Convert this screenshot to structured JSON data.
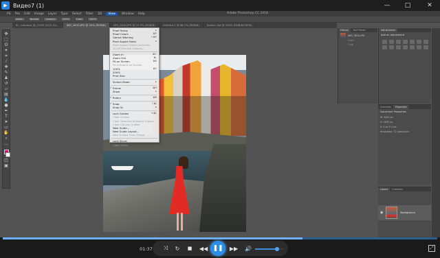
{
  "player": {
    "title": "Видео7 (1)",
    "app_icon": "play-icon",
    "window_controls": [
      "minimize-icon",
      "maximize-icon",
      "close-icon"
    ]
  },
  "photoshop": {
    "app_title": "Adobe Photoshop CC 2018",
    "menubar": [
      "PS",
      "File",
      "Edit",
      "Image",
      "Layer",
      "Type",
      "Select",
      "Filter",
      "3D",
      "View",
      "Window",
      "Help"
    ],
    "active_menu": "View",
    "options_chips": [
      "Mode:",
      "Normal",
      "Opacity:",
      "100%",
      "Flow:",
      "100%"
    ],
    "doc_tabs": [
      {
        "label": "Ki...ndscape_@_CODE 2015 (0)...",
        "active": false
      },
      {
        "label": "IMG_0610.JPG @ 25% (RGB/8)",
        "active": true
      },
      {
        "label": "IMG_0610.JPG @ 13.3% (RGB/8)",
        "active": false
      },
      {
        "label": "Untitled-1 @ 66.7% (RGB/8)",
        "active": false
      },
      {
        "label": "Screen 1pt @ 100% (RGB/8/CMYK)",
        "active": false
      }
    ]
  },
  "view_menu": [
    {
      "label": "Proof Setup",
      "shortcut": "▸",
      "disabled": false,
      "check": false
    },
    {
      "label": "Proof Colors",
      "shortcut": "⌘Y",
      "disabled": false,
      "check": false
    },
    {
      "label": "Gamut Warning",
      "shortcut": "⇧⌘Y",
      "disabled": false,
      "check": false
    },
    {
      "label": "Pixel Aspect Ratio",
      "shortcut": "▸",
      "disabled": false,
      "check": false
    },
    {
      "label": "Pixel Aspect Ratio Correction",
      "shortcut": "",
      "disabled": true,
      "check": false
    },
    {
      "label": "32-bit Preview Options...",
      "shortcut": "",
      "disabled": true,
      "check": false
    },
    {
      "sep": true
    },
    {
      "label": "Zoom In",
      "shortcut": "⌘+",
      "disabled": false,
      "check": false
    },
    {
      "label": "Zoom Out",
      "shortcut": "⌘-",
      "disabled": false,
      "check": false
    },
    {
      "label": "Fit on Screen",
      "shortcut": "⌘0",
      "disabled": false,
      "check": false
    },
    {
      "label": "Fit Artboard on Screen",
      "shortcut": "",
      "disabled": true,
      "check": false
    },
    {
      "label": "100%",
      "shortcut": "⌘1",
      "disabled": false,
      "check": false
    },
    {
      "label": "200%",
      "shortcut": "",
      "disabled": false,
      "check": false
    },
    {
      "label": "Print Size",
      "shortcut": "",
      "disabled": false,
      "check": false
    },
    {
      "sep": true
    },
    {
      "label": "Screen Mode",
      "shortcut": "▸",
      "disabled": false,
      "check": false
    },
    {
      "sep": true
    },
    {
      "label": "Extras",
      "shortcut": "⌘H",
      "disabled": false,
      "check": true
    },
    {
      "label": "Show",
      "shortcut": "▸",
      "disabled": false,
      "check": false
    },
    {
      "sep": true
    },
    {
      "label": "Rulers",
      "shortcut": "⌘R",
      "disabled": false,
      "check": true
    },
    {
      "sep": true
    },
    {
      "label": "Snap",
      "shortcut": "⇧⌘;",
      "disabled": false,
      "check": true
    },
    {
      "label": "Snap To",
      "shortcut": "▸",
      "disabled": false,
      "check": false
    },
    {
      "sep": true
    },
    {
      "label": "Lock Guides",
      "shortcut": "⌥⌘;",
      "disabled": false,
      "check": false
    },
    {
      "label": "Clear Guides",
      "shortcut": "",
      "disabled": true,
      "check": false
    },
    {
      "label": "Clear Selected Artboard Guides",
      "shortcut": "",
      "disabled": true,
      "check": false
    },
    {
      "label": "Clear Canvas Guides",
      "shortcut": "",
      "disabled": true,
      "check": false
    },
    {
      "label": "New Guide...",
      "shortcut": "",
      "disabled": false,
      "check": false
    },
    {
      "label": "New Guide Layout...",
      "shortcut": "",
      "disabled": false,
      "check": false
    },
    {
      "label": "New Guides From Shape",
      "shortcut": "",
      "disabled": true,
      "check": false
    },
    {
      "sep": true
    },
    {
      "label": "Lock Slices",
      "shortcut": "",
      "disabled": false,
      "check": false
    },
    {
      "label": "Clear Slices",
      "shortcut": "",
      "disabled": true,
      "check": false
    }
  ],
  "panels": {
    "history_tabs": [
      "History",
      "Tool Preset"
    ],
    "history_item": "IMG_0610.JPG",
    "history_sub": [
      "Open",
      "Crop"
    ],
    "adjust_tabs": [
      "Adjustments"
    ],
    "adjust_title": "Add an adjustment",
    "props_tabs": [
      "Channels",
      "Properties"
    ],
    "props_title": "Document Properties",
    "props_lines": [
      "W: 3024 px",
      "H: 4032 px",
      "X: 0 px   Y: 0 px",
      "Resolution: 72 pixels/inch"
    ],
    "layers_tabs": [
      "Layers",
      "Channels"
    ],
    "layer_name": "Background"
  },
  "video": {
    "time": "01:37",
    "progress": 0.69,
    "volume": 0.75,
    "buttons": [
      "shuffle-icon",
      "repeat-icon",
      "stop-icon",
      "rewind-icon",
      "play-pause-icon",
      "fast-forward-icon",
      "volume-icon"
    ],
    "accent": "#2a8fe8"
  }
}
